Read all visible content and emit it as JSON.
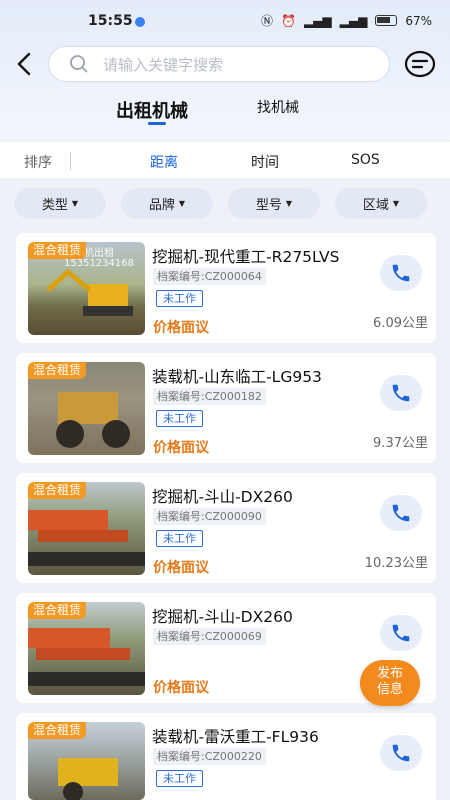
{
  "status_bar": {
    "time": "15:55",
    "battery": "67%"
  },
  "search": {
    "placeholder": "请输入关键字搜索"
  },
  "tabs": [
    {
      "label": "出租机械",
      "active": true
    },
    {
      "label": "找机械",
      "active": false
    }
  ],
  "sort": {
    "label": "排序",
    "options": [
      "距离",
      "时间",
      "SOS"
    ],
    "active": "距离"
  },
  "filters": [
    "类型",
    "品牌",
    "型号",
    "区域"
  ],
  "listings": [
    {
      "tag": "混合租赁",
      "title": "挖掘机-现代重工-R275LVS",
      "archive": "档案编号:CZ000064",
      "status": "未工作",
      "price": "价格面议",
      "distance": "6.09公里",
      "photo_overlay": [
        "雷挖机出租",
        "15351234168"
      ]
    },
    {
      "tag": "混合租赁",
      "title": "装载机-山东临工-LG953",
      "archive": "档案编号:CZ000182",
      "status": "未工作",
      "price": "价格面议",
      "distance": "9.37公里",
      "photo_overlay": []
    },
    {
      "tag": "混合租赁",
      "title": "挖掘机-斗山-DX260",
      "archive": "档案编号:CZ000090",
      "status": "未工作",
      "price": "价格面议",
      "distance": "10.23公里",
      "photo_overlay": []
    },
    {
      "tag": "混合租赁",
      "title": "挖掘机-斗山-DX260",
      "archive": "档案编号:CZ000069",
      "status": "",
      "price": "价格面议",
      "distance": "",
      "photo_overlay": []
    },
    {
      "tag": "混合租赁",
      "title": "装载机-雷沃重工-FL936",
      "archive": "档案编号:CZ000220",
      "status": "未工作",
      "price": "",
      "distance": "",
      "photo_overlay": []
    }
  ],
  "publish_button": {
    "line1": "发布",
    "line2": "信息"
  },
  "colors": {
    "accent": "#1a63d8",
    "orange": "#f29a24",
    "price": "#e57a1b"
  }
}
